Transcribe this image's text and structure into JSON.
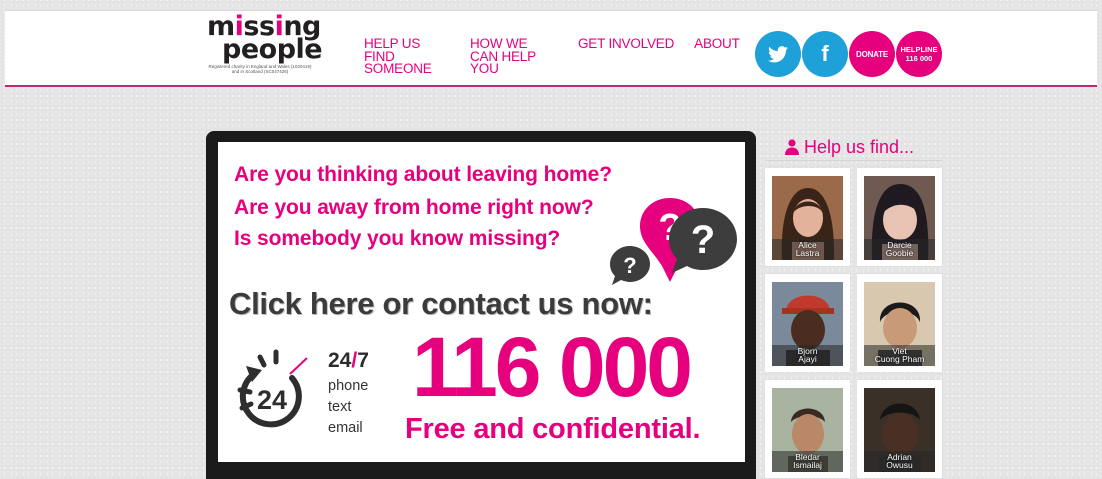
{
  "header": {
    "logo": {
      "word1_a": "m",
      "word1_b": "i",
      "word1_c": "ss",
      "word1_d": "i",
      "word1_e": "ng",
      "word2": "people",
      "reg_line1": "Registered charity in England and Wales (1020419)",
      "reg_line2": "and in Scotland (SC047426)"
    },
    "nav": [
      {
        "label": "HELP US FIND SOMEONE"
      },
      {
        "label": "HOW WE CAN HELP YOU"
      },
      {
        "label": "GET INVOLVED"
      },
      {
        "label": "ABOUT"
      }
    ],
    "twitter_icon": "twitter-icon",
    "facebook_label": "f",
    "donate_label": "DONATE",
    "helpline_label1": "HELPLINE",
    "helpline_label2": "116 000",
    "colors": {
      "brand": "#e6007e",
      "social": "#1ea0d8",
      "rule": "#c4267d"
    }
  },
  "banner": {
    "q1": "Are you thinking about leaving home?",
    "q2": "Are you away from home right now?",
    "q3": "Is somebody you know missing?",
    "cta": "Click here or contact us now:",
    "hours_a": "24",
    "hours_slash": "/",
    "hours_b": "7",
    "channels": [
      "phone",
      "text",
      "email"
    ],
    "icon_number": "24",
    "number": "116 000",
    "free": "Free and confidential."
  },
  "sidebar": {
    "title": "Help us find...",
    "people": [
      {
        "first": "Alice",
        "last": "Lastra"
      },
      {
        "first": "Darcie",
        "last": "Goobie"
      },
      {
        "first": "Bjorn",
        "last": "Ajayi"
      },
      {
        "first": "Viet",
        "last": "Cuong Pham"
      },
      {
        "first": "Bledar",
        "last": "Ismailaj"
      },
      {
        "first": "Adrian",
        "last": "Owusu"
      }
    ]
  }
}
